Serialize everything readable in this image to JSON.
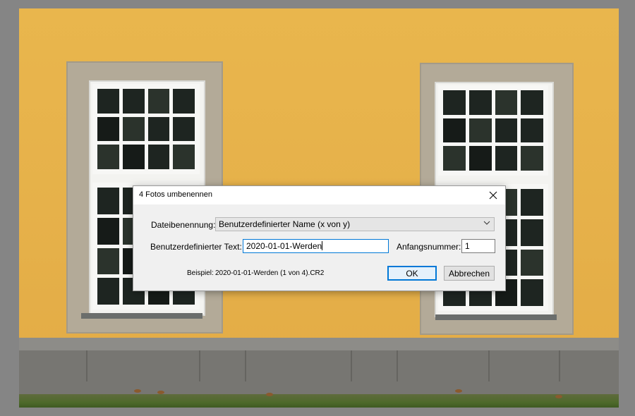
{
  "dialog": {
    "title": "4 Fotos umbenennen",
    "close_icon": "close-icon",
    "naming_label": "Dateibenennung:",
    "naming_value": "Benutzerdefinierter Name (x von y)",
    "custom_text_label": "Benutzerdefinierter Text:",
    "custom_text_value": "2020-01-01-Werden",
    "start_number_label": "Anfangsnummer:",
    "start_number_value": "1",
    "example_label": "Beispiel:",
    "example_value": "2020-01-01-Werden (1 von 4).CR2",
    "ok_label": "OK",
    "cancel_label": "Abbrechen"
  },
  "colors": {
    "accent": "#0078d7",
    "wall": "#e6b14a",
    "background": "#858585"
  }
}
